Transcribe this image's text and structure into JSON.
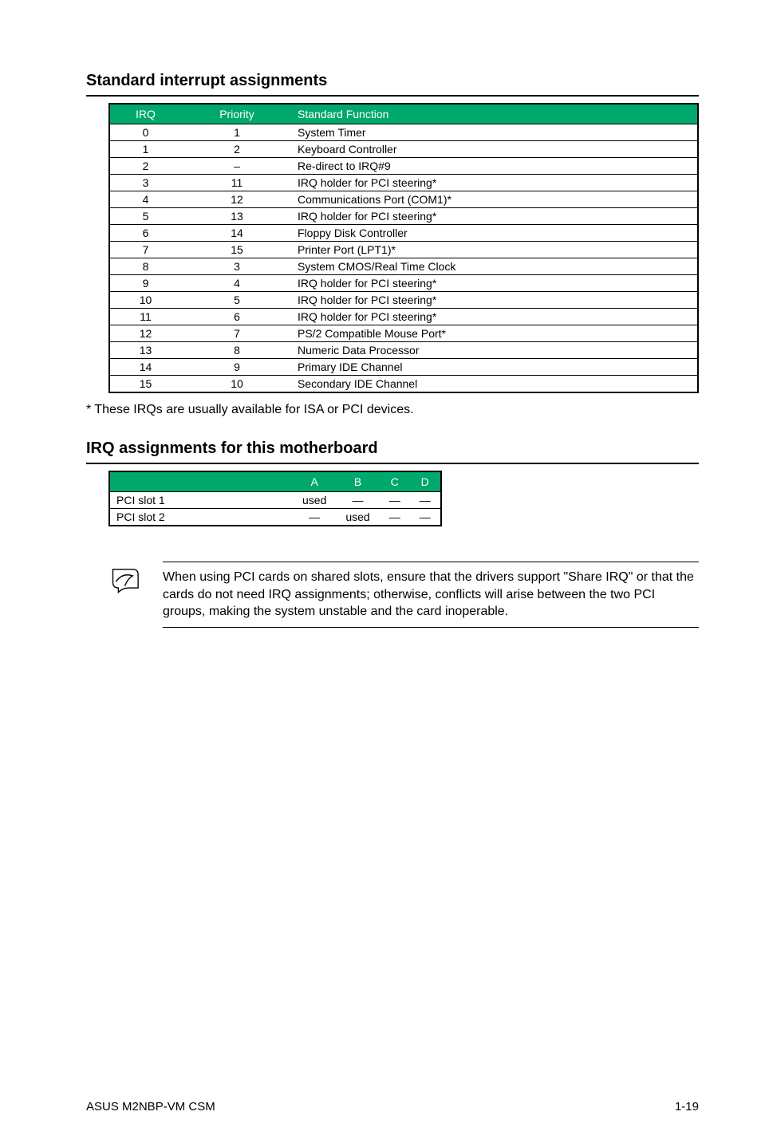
{
  "section1": {
    "title": "Standard interrupt assignments",
    "headers": {
      "irq": "IRQ",
      "priority": "Priority",
      "func": "Standard Function"
    },
    "rows": [
      {
        "irq": "0",
        "priority": "1",
        "func": "System Timer"
      },
      {
        "irq": "1",
        "priority": "2",
        "func": "Keyboard Controller"
      },
      {
        "irq": "2",
        "priority": "–",
        "func": "Re-direct to IRQ#9"
      },
      {
        "irq": "3",
        "priority": "11",
        "func": "IRQ holder for PCI steering*"
      },
      {
        "irq": "4",
        "priority": "12",
        "func": "Communications Port (COM1)*"
      },
      {
        "irq": "5",
        "priority": "13",
        "func": "IRQ holder for PCI steering*"
      },
      {
        "irq": "6",
        "priority": "14",
        "func": "Floppy Disk Controller"
      },
      {
        "irq": "7",
        "priority": "15",
        "func": "Printer Port (LPT1)*"
      },
      {
        "irq": "8",
        "priority": "3",
        "func": "System CMOS/Real Time Clock"
      },
      {
        "irq": "9",
        "priority": "4",
        "func": "IRQ holder for PCI steering*"
      },
      {
        "irq": "10",
        "priority": "5",
        "func": "IRQ holder for PCI steering*"
      },
      {
        "irq": "11",
        "priority": "6",
        "func": "IRQ holder for PCI steering*"
      },
      {
        "irq": "12",
        "priority": "7",
        "func": "PS/2 Compatible Mouse Port*"
      },
      {
        "irq": "13",
        "priority": "8",
        "func": "Numeric Data Processor"
      },
      {
        "irq": "14",
        "priority": "9",
        "func": "Primary IDE Channel"
      },
      {
        "irq": "15",
        "priority": "10",
        "func": "Secondary IDE Channel"
      }
    ],
    "footnote": "* These IRQs are usually available for ISA or PCI devices."
  },
  "section2": {
    "title": "IRQ assignments for this motherboard",
    "headers": {
      "a": "A",
      "b": "B",
      "c": "C",
      "d": "D"
    },
    "rows": [
      {
        "label": "PCI slot 1",
        "a": "used",
        "b": "—",
        "c": "—",
        "d": "—"
      },
      {
        "label": "PCI slot 2",
        "a": "—",
        "b": "used",
        "c": "—",
        "d": "—"
      }
    ]
  },
  "note": {
    "text": "When using PCI cards on shared slots, ensure that the drivers support \"Share IRQ\" or that the cards do not need IRQ assignments; otherwise, conflicts will arise between the two PCI groups, making the system unstable and the card inoperable."
  },
  "footer": {
    "left": "ASUS M2NBP-VM CSM",
    "right": "1-19"
  }
}
